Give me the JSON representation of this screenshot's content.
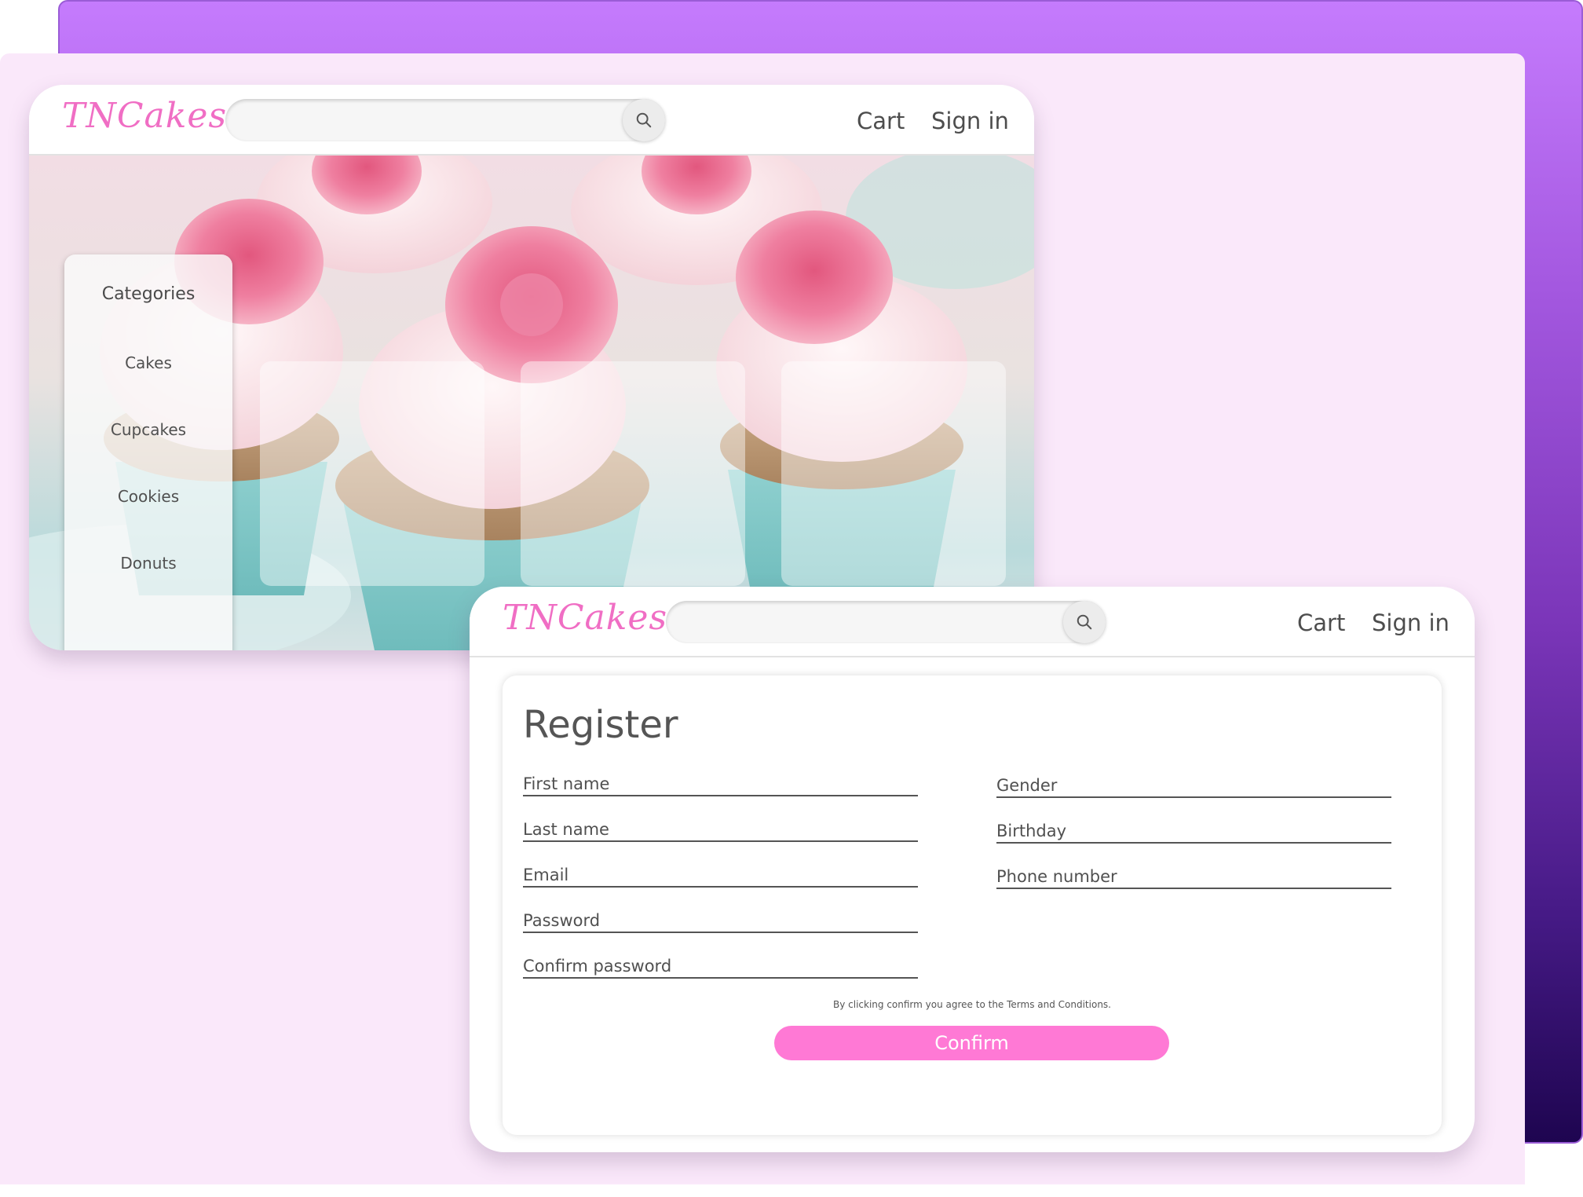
{
  "brand": {
    "logo_text": "TNCakes",
    "accent_color": "#ff79d5",
    "logo_color": "#f06ec4",
    "backdrop_gradient": [
      "#c57bfd",
      "#1e0550"
    ],
    "page_background": "#fae8fa"
  },
  "header": {
    "search_placeholder": "",
    "search_icon": "search-icon",
    "cart_label": "Cart",
    "signin_label": "Sign in"
  },
  "home": {
    "categories": {
      "heading": "Categories",
      "items": [
        {
          "label": "Cakes"
        },
        {
          "label": "Cupcakes"
        },
        {
          "label": "Cookies"
        },
        {
          "label": "Donuts"
        }
      ]
    },
    "product_cards": 3
  },
  "register": {
    "title": "Register",
    "left_fields": [
      {
        "label": "First name"
      },
      {
        "label": "Last name"
      },
      {
        "label": "Email"
      },
      {
        "label": "Password"
      },
      {
        "label": "Confirm password"
      }
    ],
    "right_fields": [
      {
        "label": "Gender"
      },
      {
        "label": "Birthday"
      },
      {
        "label": "Phone number"
      }
    ],
    "terms_text": "By clicking confirm you agree to the Terms and Conditions.",
    "confirm_label": "Confirm"
  }
}
